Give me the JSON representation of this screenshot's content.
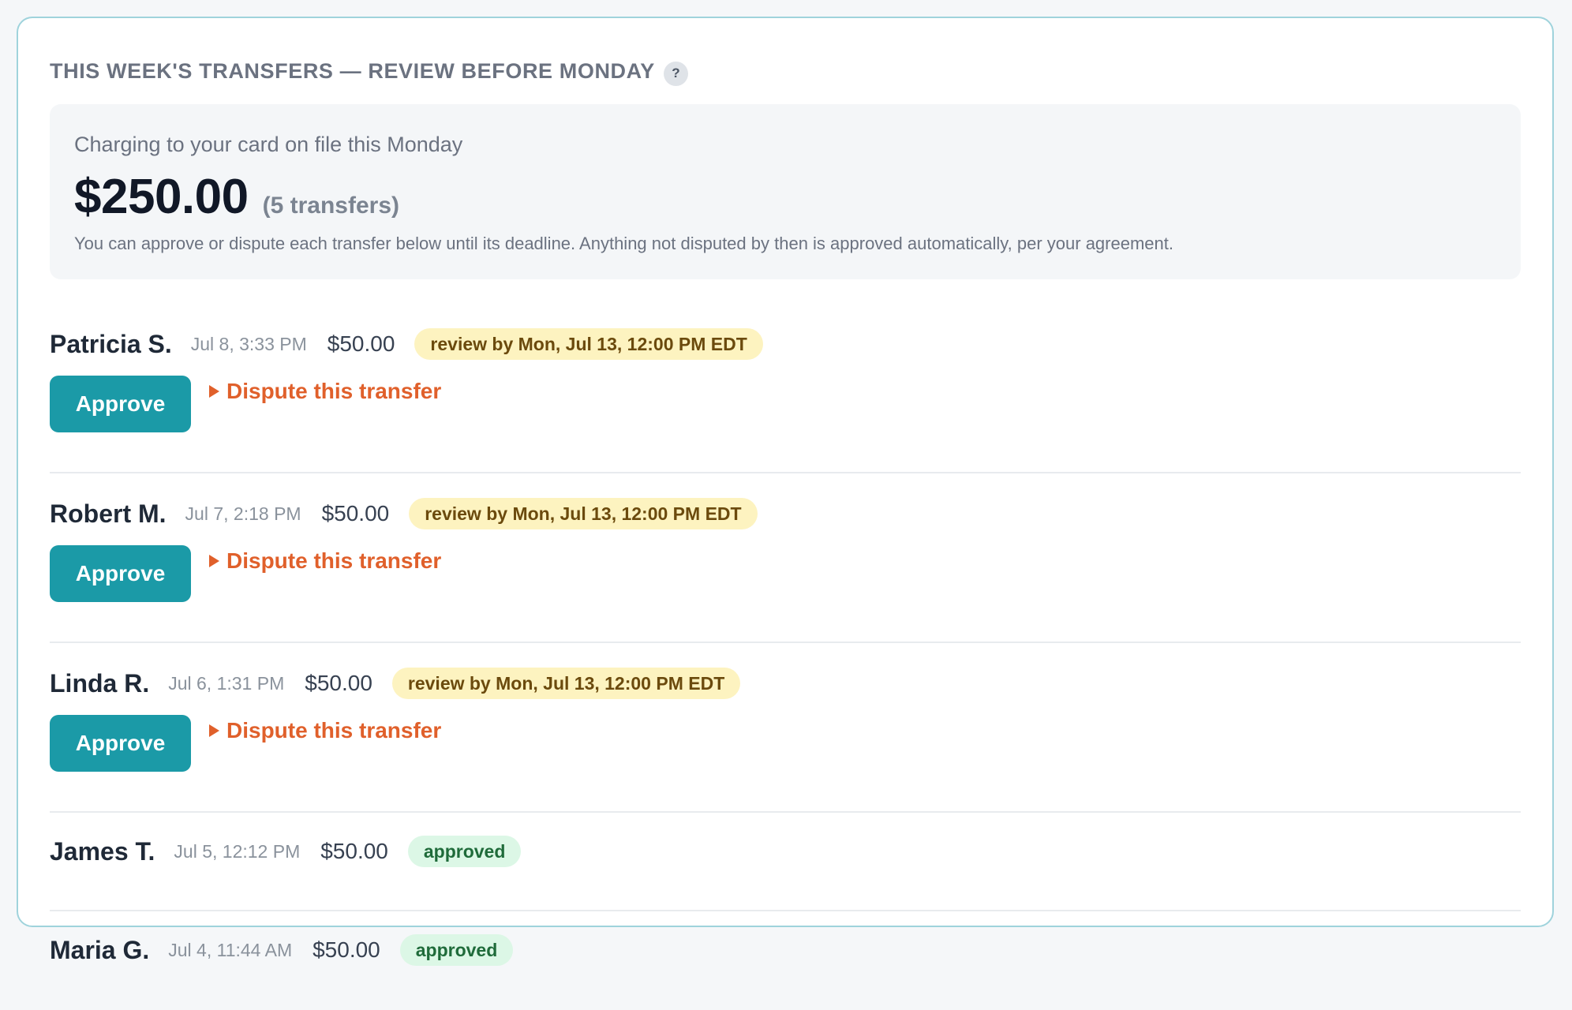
{
  "header": {
    "title": "THIS WEEK'S TRANSFERS — REVIEW BEFORE MONDAY",
    "help_icon": "?"
  },
  "summary": {
    "caption": "Charging to your card on file this Monday",
    "amount": "$250.00",
    "count": "(5 transfers)",
    "note": "You can approve or dispute each transfer below until its deadline. Anything not disputed by then is approved automatically, per your agreement."
  },
  "actions": {
    "approve_label": "Approve",
    "dispute_label": "Dispute this transfer"
  },
  "colors": {
    "accent": "#1b9aa7",
    "dispute": "#e0602b",
    "review_badge_bg": "#fdf3c0",
    "approved_badge_bg": "#dcf7e6"
  },
  "transfers": [
    {
      "name": "Patricia S.",
      "time": "Jul 8, 3:33 PM",
      "amount": "$50.00",
      "status": "review by Mon, Jul 13, 12:00 PM EDT"
    },
    {
      "name": "Robert M.",
      "time": "Jul 7, 2:18 PM",
      "amount": "$50.00",
      "status": "review by Mon, Jul 13, 12:00 PM EDT"
    },
    {
      "name": "Linda R.",
      "time": "Jul 6, 1:31 PM",
      "amount": "$50.00",
      "status": "review by Mon, Jul 13, 12:00 PM EDT"
    },
    {
      "name": "James T.",
      "time": "Jul 5, 12:12 PM",
      "amount": "$50.00",
      "status": "approved"
    },
    {
      "name": "Maria G.",
      "time": "Jul 4, 11:44 AM",
      "amount": "$50.00",
      "status": "approved"
    }
  ]
}
